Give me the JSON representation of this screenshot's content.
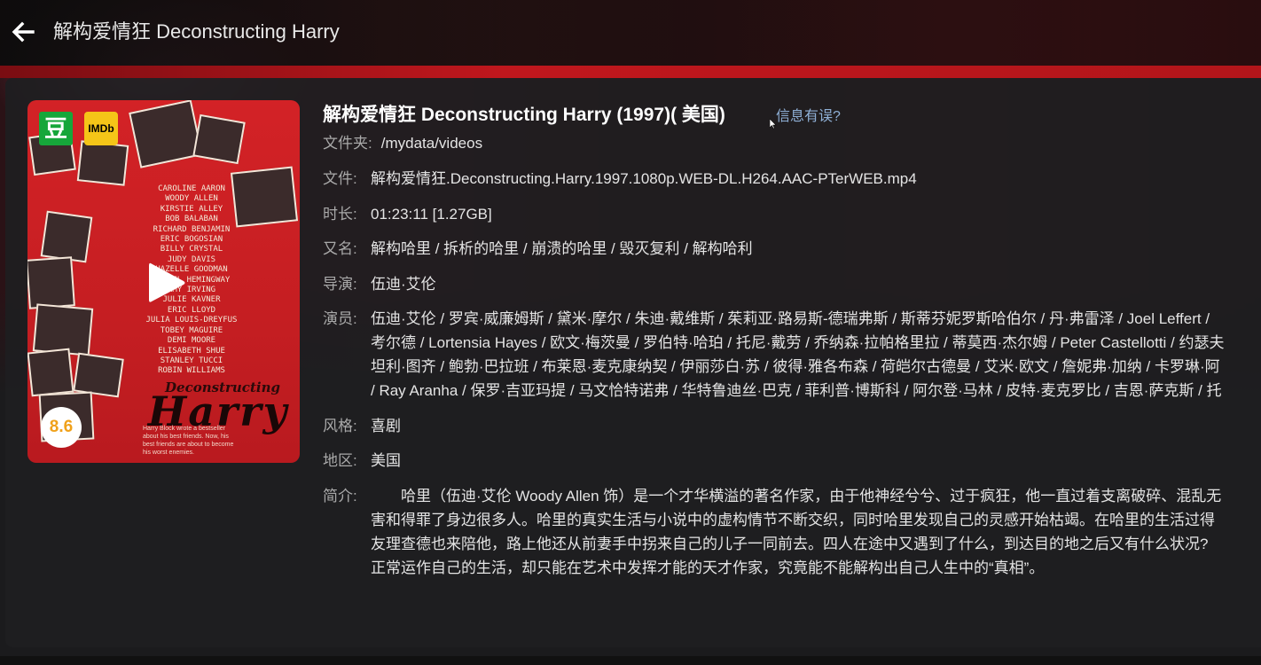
{
  "header": {
    "title": "解构爱情狂 Deconstructing Harry"
  },
  "poster": {
    "douban_badge": "豆",
    "imdb_badge": "IMDb",
    "rating": "8.6",
    "credits": [
      "CAROLINE AARON",
      "WOODY ALLEN",
      "KIRSTIE ALLEY",
      "BOB BALABAN",
      "RICHARD BENJAMIN",
      "ERIC BOGOSIAN",
      "BILLY CRYSTAL",
      "JUDY DAVIS",
      "HAZELLE GOODMAN",
      "MARIEL HEMINGWAY",
      "AMY IRVING",
      "JULIE KAVNER",
      "ERIC LLOYD",
      "JULIA LOUIS-DREYFUS",
      "TOBEY MAGUIRE",
      "DEMI MOORE",
      "ELISABETH SHUE",
      "STANLEY TUCCI",
      "ROBIN WILLIAMS"
    ],
    "title_small": "Deconstructing",
    "title_big": "Harry",
    "tagline": "Harry Block wrote a bestseller about his best friends. Now, his best friends are about to become his worst enemies."
  },
  "movie": {
    "title": "解构爱情狂 Deconstructing Harry (1997)( 美国)",
    "report_link": "信息有误?",
    "folder_label": "文件夹:",
    "folder": "/mydata/videos",
    "file_label": "文件:",
    "file": "解构爱情狂.Deconstructing.Harry.1997.1080p.WEB-DL.H264.AAC-PTerWEB.mp4",
    "duration_label": "时长:",
    "duration": "01:23:11 [1.27GB]",
    "aka_label": "又名:",
    "aka": "解构哈里 / 拆析的哈里 / 崩溃的哈里 / 毁灭复利 / 解构哈利",
    "director_label": "导演:",
    "director": "伍迪·艾伦",
    "cast_label": "演员:",
    "cast_lines": [
      "伍迪·艾伦 / 罗宾·威廉姆斯 / 黛米·摩尔 / 朱迪·戴维斯 / 茱莉亚·路易斯-德瑞弗斯 / 斯蒂芬妮罗斯哈伯尔 / 丹·弗雷泽 / Joel Leffert /",
      "考尔德 / Lortensia Hayes / 欧文·梅茨曼 / 罗伯特·哈珀 / 托尼·戴劳 / 乔纳森·拉帕格里拉 / 蒂莫西·杰尔姆 / Peter Castellotti / 约瑟夫",
      "坦利·图齐 / 鲍勃·巴拉班 / 布莱恩·麦克康纳契 / 伊丽莎白·苏 / 彼得·雅各布森 / 荷皑尔古德曼 / 艾米·欧文 / 詹妮弗·加纳 / 卡罗琳·阿",
      "/ Ray Aranha / 保罗·吉亚玛提 / 马文恰特诺弗 / 华特鲁迪丝·巴克 / 菲利普·博斯科 / 阿尔登·马林 / 皮特·麦克罗比 / 吉恩·萨克斯 / 托"
    ],
    "genre_label": "风格:",
    "genre": "喜剧",
    "region_label": "地区:",
    "region": "美国",
    "summary_label": "简介:",
    "summary_lines": [
      "　　哈里（伍迪·艾伦 Woody Allen 饰）是一个才华横溢的著名作家，由于他神经兮兮、过于疯狂，他一直过着支离破碎、混乱无",
      "害和得罪了身边很多人。哈里的真实生活与小说中的虚构情节不断交织，同时哈里发现自己的灵感开始枯竭。在哈里的生活过得",
      "友理查德也来陪他，路上他还从前妻手中拐来自己的儿子一同前去。四人在途中又遇到了什么，到达目的地之后又有什么状况?",
      "正常运作自己的生活，却只能在艺术中发挥才能的天才作家，究竟能不能解构出自己人生中的“真相”。"
    ]
  }
}
